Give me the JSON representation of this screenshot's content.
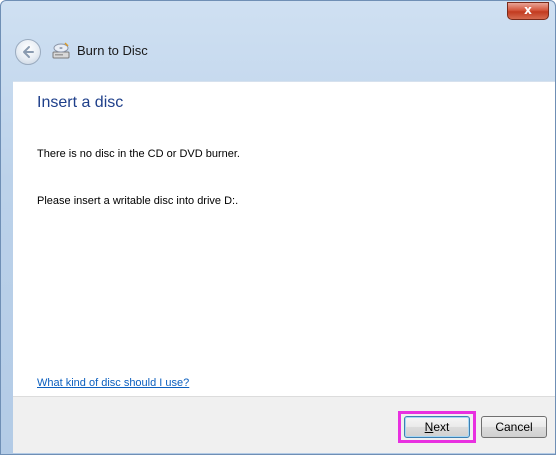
{
  "window": {
    "close_glyph": "x"
  },
  "nav": {
    "back_icon": "back-arrow-icon",
    "app_icon": "burn-disc-icon",
    "title": "Burn to Disc"
  },
  "content": {
    "heading": "Insert a disc",
    "message_1": "There is no disc in the CD or DVD burner.",
    "message_2": "Please insert a writable disc into drive D:.",
    "help_link": "What kind of disc should I use?"
  },
  "footer": {
    "next_mnemonic": "N",
    "next_rest": "ext",
    "cancel_label": "Cancel",
    "highlight_color": "#e830e0"
  }
}
